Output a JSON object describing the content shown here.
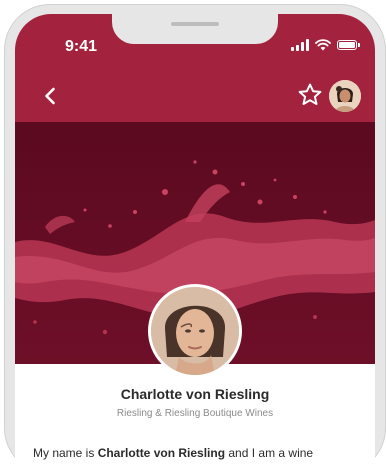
{
  "status_bar": {
    "time": "9:41"
  },
  "header": {
    "back_icon": "chevron-left-icon",
    "favorite_icon": "star-outline-icon",
    "avatar": "user-avatar"
  },
  "profile": {
    "name": "Charlotte von Riesling",
    "company": "Riesling & Riesling Boutique Wines",
    "bio_prefix": "My name is ",
    "bio_name": "Charlotte von Riesling",
    "bio_suffix": " and I am a wine"
  },
  "colors": {
    "brand": "#a3233f",
    "hero_dark": "#6a0d25"
  }
}
